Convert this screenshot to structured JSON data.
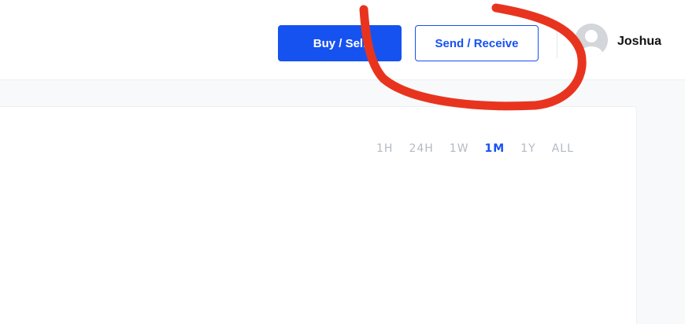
{
  "header": {
    "buy_sell_label": "Buy / Sell",
    "send_receive_label": "Send / Receive",
    "user_name": "Joshua"
  },
  "chart": {
    "range_tabs": [
      "1H",
      "24H",
      "1W",
      "1M",
      "1Y",
      "ALL"
    ],
    "active_range": "1M"
  },
  "colors": {
    "accent": "#1652f0",
    "annotation": "#e8341f"
  }
}
